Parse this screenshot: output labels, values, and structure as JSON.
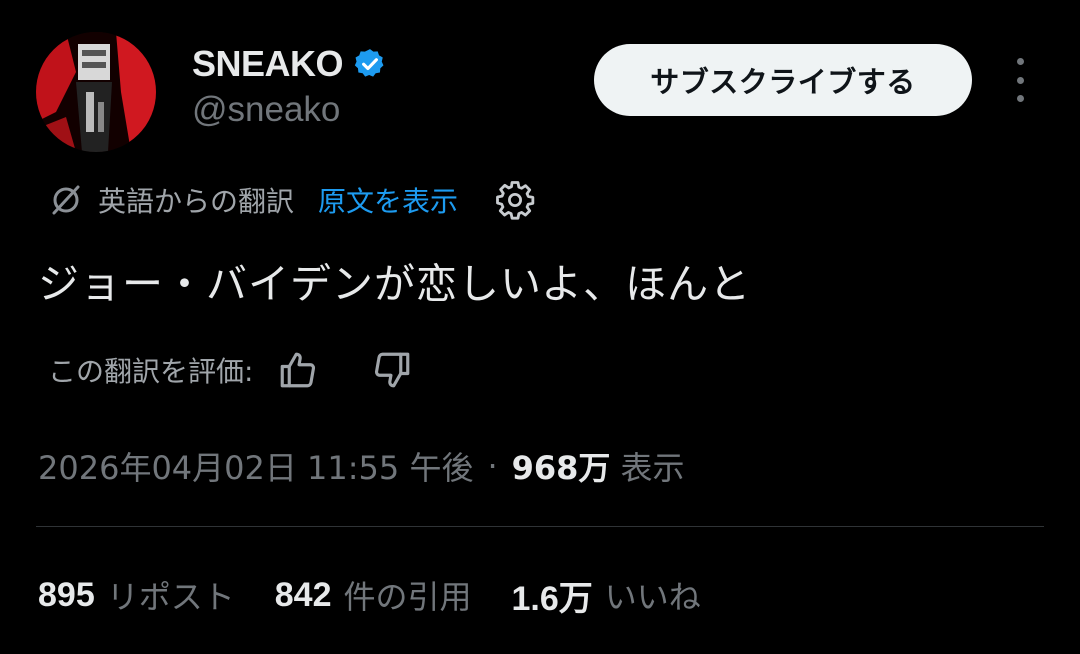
{
  "author": {
    "display_name": "SNEAKO",
    "handle": "@sneako",
    "verified": true,
    "verified_color": "#1d9bf0",
    "avatar_icon": "profile-photo-red-icon"
  },
  "header": {
    "subscribe_label": "サブスクライブする",
    "more_icon": "more-vertical-icon"
  },
  "translation": {
    "icon": "translate-icon",
    "translated_from": "英語からの翻訳",
    "show_original": "原文を表示",
    "settings_icon": "gear-icon",
    "link_color": "#1d9bf0"
  },
  "tweet": {
    "text": "ジョー・バイデンが恋しいよ、ほんと"
  },
  "rating": {
    "label": "この翻訳を評価:",
    "thumbs_up_icon": "thumbs-up-icon",
    "thumbs_down_icon": "thumbs-down-icon"
  },
  "meta": {
    "timestamp": "2026年04月02日 11:55 午後",
    "separator": "·",
    "views_count": "968万",
    "views_label": "表示"
  },
  "stats": {
    "reposts_count": "895",
    "reposts_label": "リポスト",
    "quotes_count": "842",
    "quotes_label": "件の引用",
    "likes_count": "1.6万",
    "likes_label": "いいね"
  }
}
